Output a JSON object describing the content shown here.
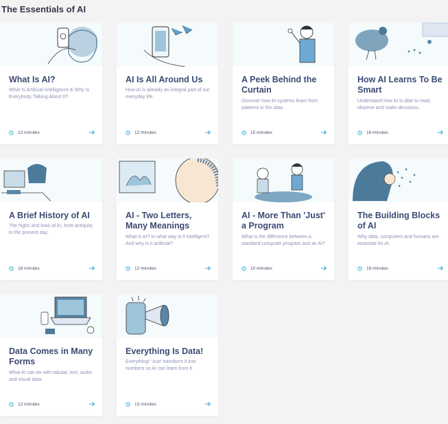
{
  "section": {
    "title": "The Essentials of AI"
  },
  "cards": [
    {
      "title": "What Is AI?",
      "description": "What Is Artificial Intelligence & Why Is Everybody Talking About It?",
      "duration": "12 minutes"
    },
    {
      "title": "AI Is All Around Us",
      "description": "How AI is already an integral part of our everyday life.",
      "duration": "12 minutes"
    },
    {
      "title": "A Peek Behind the Curtain",
      "description": "Discover how AI systems learn from patterns in the data.",
      "duration": "15 minutes"
    },
    {
      "title": "How AI Learns To Be Smart",
      "description": "Understand how AI is able to read, observe and make decisions.",
      "duration": "16 minutes"
    },
    {
      "title": "A Brief History of AI",
      "description": "The highs and lows of AI, from antiquity to the present day.",
      "duration": "16 minutes"
    },
    {
      "title": "AI - Two Letters, Many Meanings",
      "description": "What is AI? In what way is it intelligent? And why is it artificial?",
      "duration": "12 minutes"
    },
    {
      "title": "AI - More Than 'Just' a Program",
      "description": "What is the difference between a standard computer program and an AI?",
      "duration": "10 minutes"
    },
    {
      "title": "The Building Blocks of AI",
      "description": "Why data, computers and humans are essential for AI.",
      "duration": "18 minutes"
    },
    {
      "title": "Data Comes in Many Forms",
      "description": "What AI can do with tabular, text, audio and visual data.",
      "duration": "12 minutes"
    },
    {
      "title": "Everything Is Data!",
      "description": "Everything! 'Just' transform it into numbers so AI can learn from it.",
      "duration": "13 minutes"
    }
  ],
  "icons": {
    "clock": "clock-icon",
    "arrow": "arrow-right-icon"
  },
  "colors": {
    "accent": "#2aa8d8",
    "title": "#3c4b73",
    "illustration": "#5a87a8"
  }
}
